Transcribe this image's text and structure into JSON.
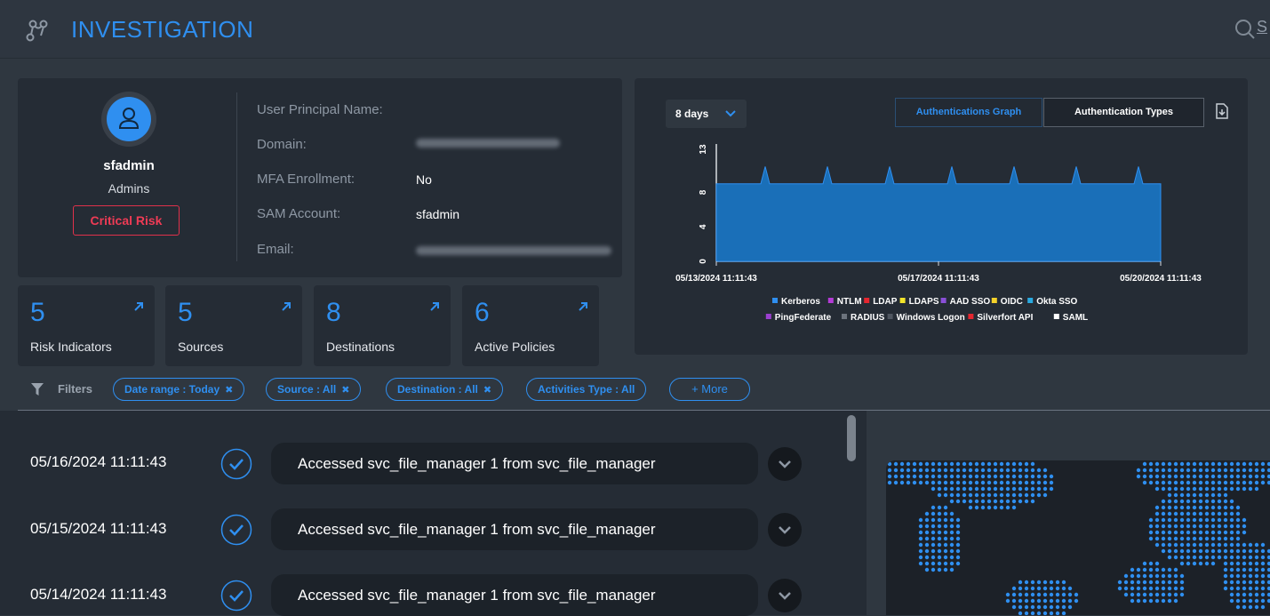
{
  "header": {
    "title": "INVESTIGATION",
    "search_hint": "S"
  },
  "profile": {
    "name": "sfadmin",
    "group": "Admins",
    "risk": "Critical Risk",
    "fields": [
      {
        "label": "User Principal Name:",
        "value": ""
      },
      {
        "label": "Domain:",
        "value": ""
      },
      {
        "label": "MFA Enrollment:",
        "value": "No"
      },
      {
        "label": "SAM Account:",
        "value": "sfadmin"
      },
      {
        "label": "Email:",
        "value": ""
      }
    ]
  },
  "stats": [
    {
      "value": "5",
      "label": "Risk Indicators"
    },
    {
      "value": "5",
      "label": "Sources"
    },
    {
      "value": "8",
      "label": "Destinations"
    },
    {
      "value": "6",
      "label": "Active Policies"
    }
  ],
  "graph": {
    "range": "8 days",
    "tab_active": "Authentications Graph",
    "tab_other": "Authentication Types"
  },
  "chart_data": {
    "type": "area",
    "x_ticks": [
      "05/13/2024 11:11:43",
      "05/17/2024 11:11:43",
      "05/20/2024 11:11:43"
    ],
    "y_ticks": [
      0,
      4,
      8,
      13
    ],
    "ylim": [
      0,
      13
    ],
    "x": [
      0,
      0.1,
      0.11,
      0.12,
      0.2,
      0.24,
      0.25,
      0.26,
      0.34,
      0.38,
      0.39,
      0.4,
      0.48,
      0.52,
      0.53,
      0.54,
      0.62,
      0.66,
      0.67,
      0.68,
      0.76,
      0.8,
      0.81,
      0.82,
      0.9,
      0.94,
      0.95,
      0.96,
      1.0
    ],
    "series": [
      {
        "name": "Kerberos",
        "values": [
          9,
          9,
          11,
          9,
          9,
          9,
          11,
          9,
          9,
          9,
          11,
          9,
          9,
          9,
          11,
          9,
          9,
          9,
          11,
          9,
          9,
          9,
          11,
          9,
          9,
          9,
          11,
          9,
          9
        ]
      }
    ],
    "legend": [
      {
        "name": "Kerberos",
        "color": "#2f8ff0"
      },
      {
        "name": "NTLM",
        "color": "#b43bd6"
      },
      {
        "name": "LDAP",
        "color": "#e5262f"
      },
      {
        "name": "LDAPS",
        "color": "#f2e42a"
      },
      {
        "name": "AAD SSO",
        "color": "#8a4fd8"
      },
      {
        "name": "OIDC",
        "color": "#f5d22a"
      },
      {
        "name": "Okta SSO",
        "color": "#29a9e0"
      },
      {
        "name": "PingFederate",
        "color": "#9b3fd0"
      },
      {
        "name": "RADIUS",
        "color": "#6c737d"
      },
      {
        "name": "Windows Logon",
        "color": "#4f5660"
      },
      {
        "name": "Silverfort API",
        "color": "#e5262f"
      },
      {
        "name": "SAML",
        "color": "#ffffff"
      }
    ]
  },
  "filters": {
    "label": "Filters",
    "chips": [
      {
        "text": "Date range : Today",
        "removable": true
      },
      {
        "text": "Source : All",
        "removable": true
      },
      {
        "text": "Destination : All",
        "removable": true
      },
      {
        "text": "Activities Type : All",
        "removable": false
      }
    ],
    "more": "+ More"
  },
  "activities": [
    {
      "date": "05/16/2024 11:11:43",
      "text": "Accessed svc_file_manager 1 from svc_file_manager"
    },
    {
      "date": "05/15/2024 11:11:43",
      "text": "Accessed svc_file_manager 1 from svc_file_manager"
    },
    {
      "date": "05/14/2024 11:11:43",
      "text": "Accessed svc_file_manager 1 from svc_file_manager"
    }
  ],
  "colors": {
    "accent": "#2f8ff0",
    "danger": "#ef3b55",
    "panel": "#252c35",
    "background": "#2f3740"
  }
}
